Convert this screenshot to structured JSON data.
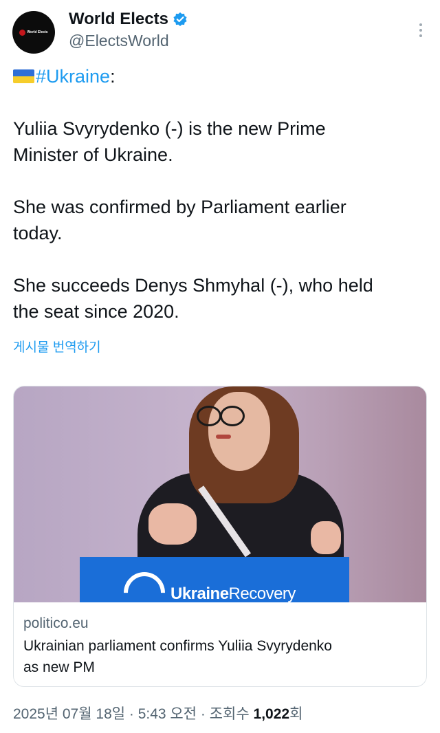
{
  "author": {
    "display_name": "World Elects",
    "handle": "@ElectsWorld",
    "avatar_text": "World Elects",
    "verified": true
  },
  "tweet": {
    "hashtag": "#Ukraine",
    "hashtag_suffix": ":",
    "lines": [
      "Yuliia Svyrydenko (-) is the new Prime",
      "Minister of Ukraine.",
      "She was confirmed by Parliament earlier",
      "today.",
      "She succeeds Denys Shmyhal (-), who held",
      "the seat since 2020."
    ],
    "translate_label": "게시물 번역하기"
  },
  "card": {
    "image_podium_text_bold": "Ukraine",
    "image_podium_text_rest": "Recovery",
    "domain": "politico.eu",
    "title_line1": "Ukrainian parliament confirms Yuliia Svyrydenko",
    "title_line2": "as new PM"
  },
  "meta": {
    "timestamp": "2025년 07월 18일 · 5:43 오전 · 조회수 ",
    "views_count": "1,022",
    "views_suffix": "회"
  },
  "colors": {
    "accent": "#1d9bf0",
    "text": "#0f1419",
    "muted": "#536471",
    "flag_blue": "#2f6fd6",
    "flag_yellow": "#f6cd2b"
  },
  "icons": {
    "verified": "verified-badge-icon",
    "more": "more-options-icon",
    "flag": "ukraine-flag-icon"
  }
}
